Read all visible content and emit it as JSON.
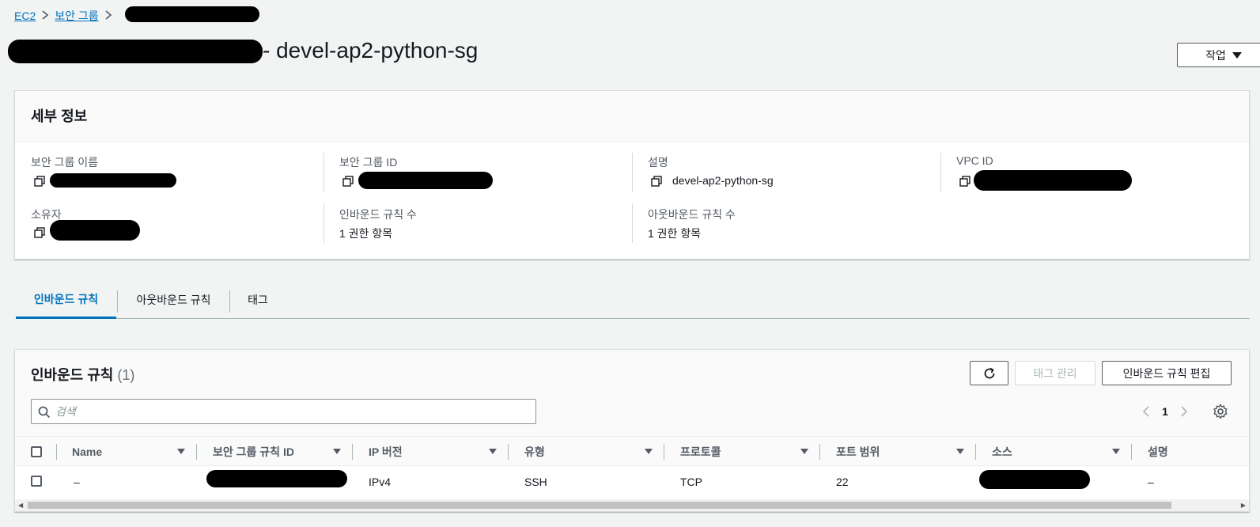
{
  "breadcrumb": {
    "items": [
      "EC2",
      "보안 그룹"
    ]
  },
  "page": {
    "title_suffix": "- devel-ap2-python-sg",
    "actions_label": "작업"
  },
  "details": {
    "title": "세부 정보",
    "fields": {
      "sg_name": {
        "label": "보안 그룹 이름"
      },
      "sg_id": {
        "label": "보안 그룹 ID"
      },
      "description": {
        "label": "설명",
        "value": "devel-ap2-python-sg"
      },
      "vpc_id": {
        "label": "VPC ID"
      },
      "owner": {
        "label": "소유자"
      },
      "inbound_count": {
        "label": "인바운드 규칙 수",
        "value": "1 권한 항목"
      },
      "outbound_count": {
        "label": "아웃바운드 규칙 수",
        "value": "1 권한 항목"
      }
    }
  },
  "tabs": [
    {
      "label": "인바운드 규칙",
      "active": true
    },
    {
      "label": "아웃바운드 규칙",
      "active": false
    },
    {
      "label": "태그",
      "active": false
    }
  ],
  "rules": {
    "title": "인바운드 규칙",
    "count": "(1)",
    "buttons": {
      "manage_tags": "태그 관리",
      "edit_inbound": "인바운드 규칙 편집"
    },
    "search": {
      "placeholder": "검색"
    },
    "page_number": "1",
    "columns": [
      "Name",
      "보안 그룹 규칙 ID",
      "IP 버전",
      "유형",
      "프로토콜",
      "포트 범위",
      "소스",
      "설명"
    ],
    "rows": [
      {
        "name": "–",
        "ip_version": "IPv4",
        "type": "SSH",
        "protocol": "TCP",
        "port_range": "22",
        "description": "–"
      }
    ]
  },
  "colors": {
    "link": "#0073bb",
    "background": "#f2f3f3",
    "border": "#d5dbdb"
  }
}
